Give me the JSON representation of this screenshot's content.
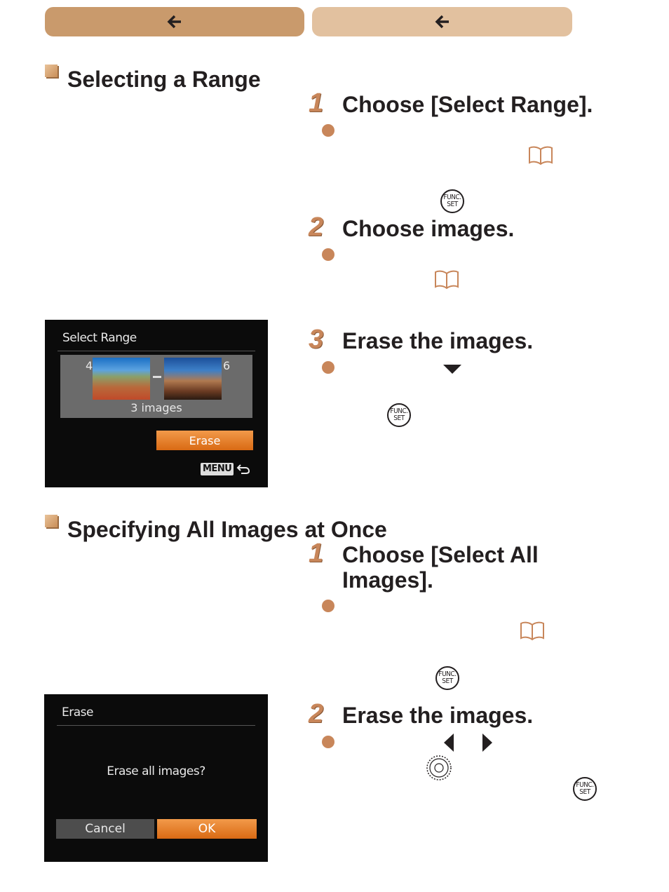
{
  "nav": {
    "prev_icon": "arrow-left-icon",
    "next_icon": "arrow-left-icon"
  },
  "section1": {
    "title": "Selecting a Range",
    "steps": [
      {
        "number": "1",
        "title": "Choose [Select Range]."
      },
      {
        "number": "2",
        "title": "Choose images."
      },
      {
        "number": "3",
        "title": "Erase the images."
      }
    ]
  },
  "screen1": {
    "title": "Select Range",
    "start_number": "4",
    "end_number": "6",
    "count": "3 images",
    "erase_button": "Erase",
    "menu_label": "MENU"
  },
  "section2": {
    "title": "Specifying All Images at Once",
    "steps": [
      {
        "number": "1",
        "title_line1": "Choose [Select All",
        "title_line2": "Images]."
      },
      {
        "number": "2",
        "title": "Erase the images."
      }
    ]
  },
  "screen2": {
    "title": "Erase",
    "message": "Erase all images?",
    "cancel_button": "Cancel",
    "ok_button": "OK"
  },
  "func_icon": {
    "top": "FUNC.",
    "bottom": "SET"
  },
  "colors": {
    "accent": "#c8865a",
    "nav_prev": "#c99a6c",
    "nav_next": "#e2c19f",
    "camera_button": "#d96a14"
  }
}
